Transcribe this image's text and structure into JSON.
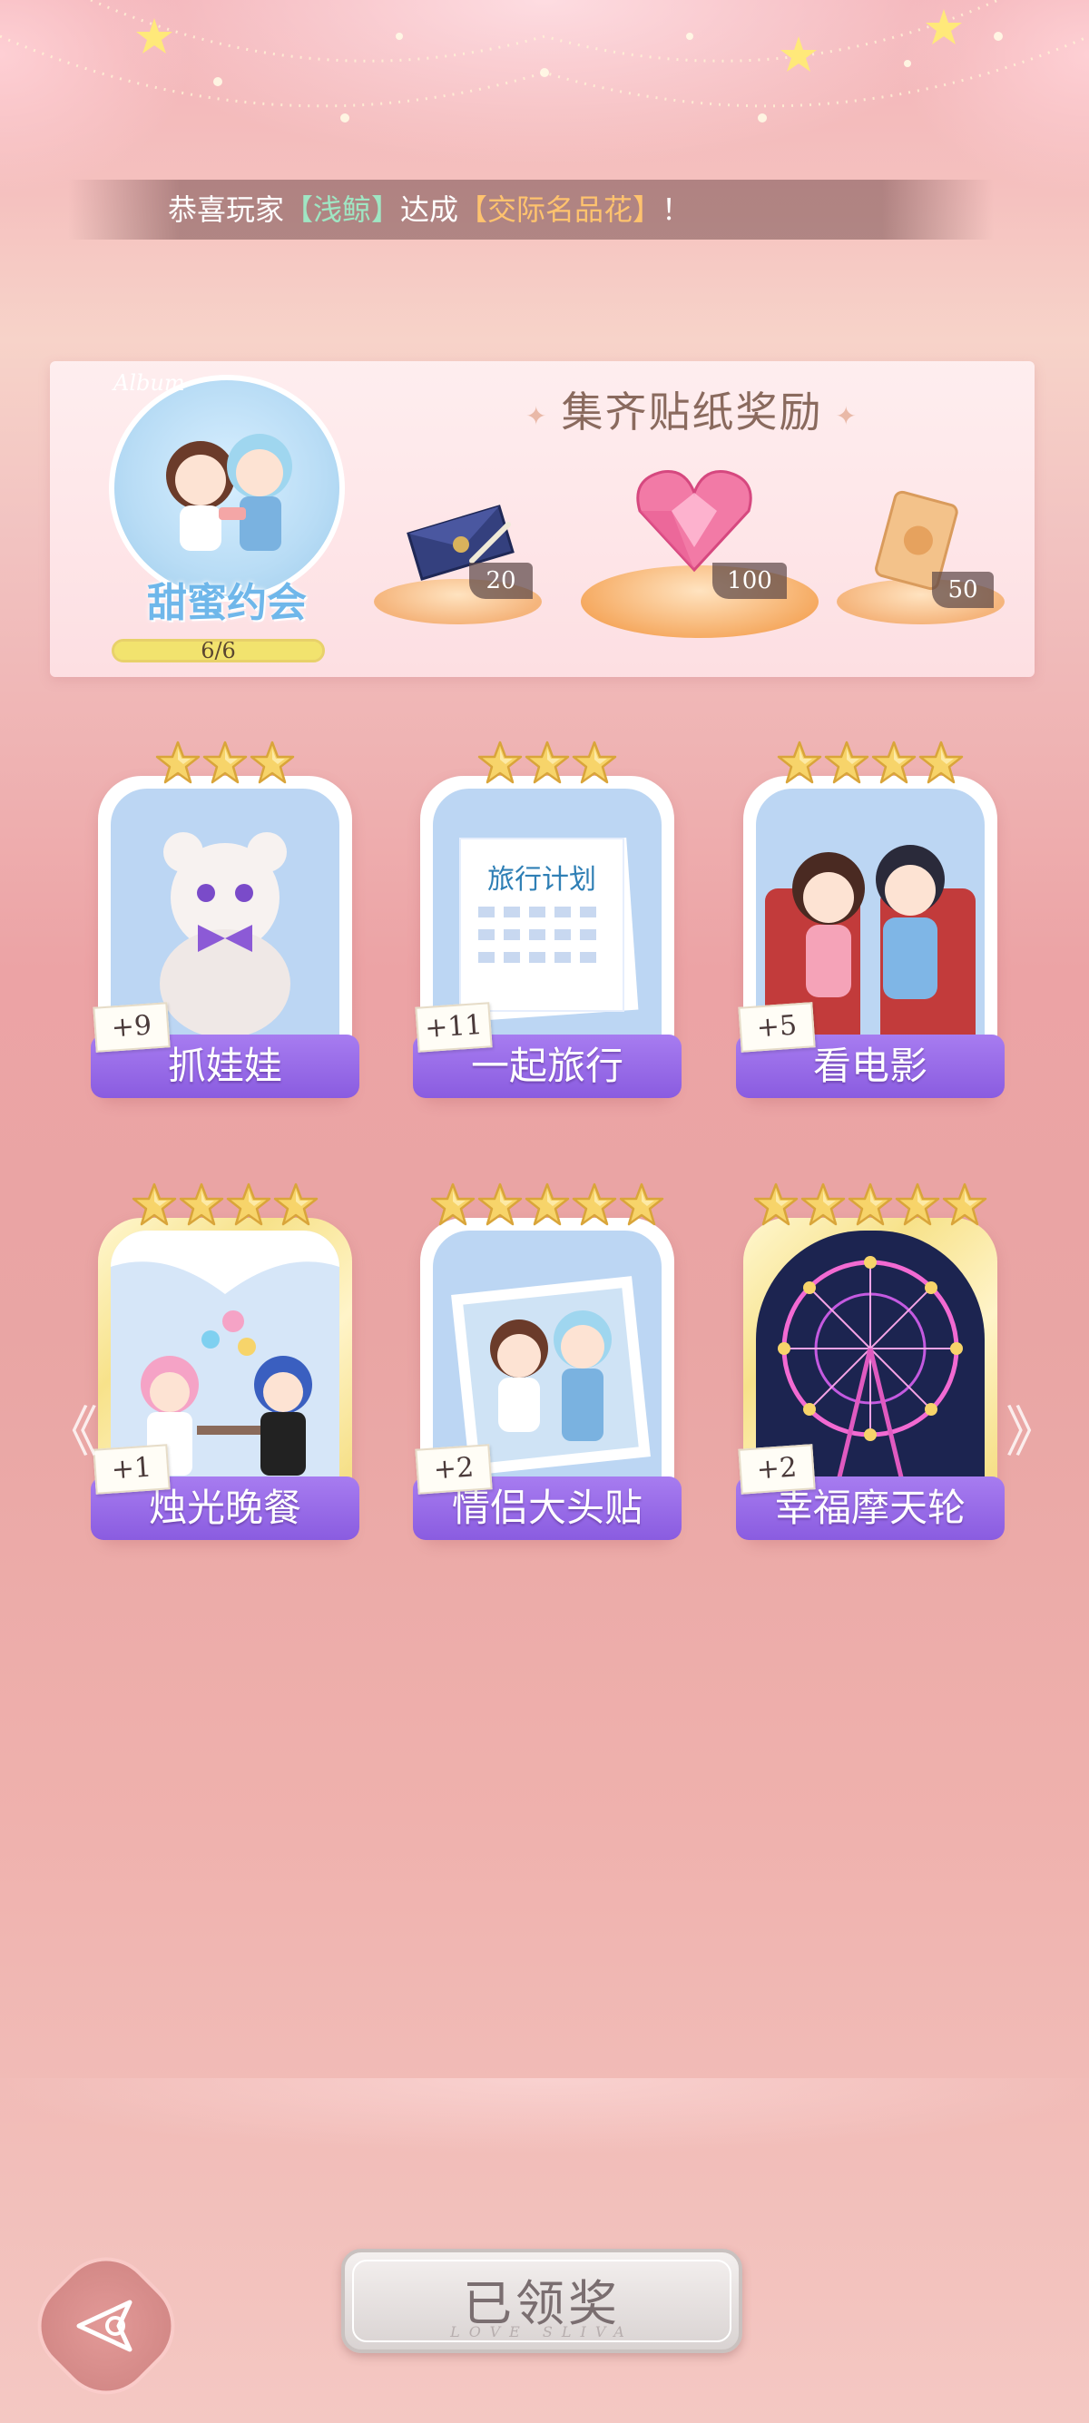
{
  "announcement": {
    "prefix": "恭喜玩家",
    "player": "【浅鲸】",
    "middle": "达成",
    "title": "【交际名品花】",
    "suffix": "！"
  },
  "album": {
    "label": "Album",
    "name": "甜蜜约会",
    "progress_text": "6/6",
    "progress_fraction": 1.0
  },
  "rewards": {
    "title": "集齐贴纸奖励",
    "items": [
      {
        "icon": "envelope-icon",
        "count": "20"
      },
      {
        "icon": "pink-heart-gem-icon",
        "count": "100"
      },
      {
        "icon": "gold-card-icon",
        "count": "50"
      }
    ]
  },
  "stickers": [
    {
      "name": "抓娃娃",
      "count": "+9",
      "stars": 3,
      "gold": false,
      "icon": "teddy-bear-icon"
    },
    {
      "name": "一起旅行",
      "count": "+11",
      "stars": 3,
      "gold": false,
      "icon": "travel-plan-calendar-icon"
    },
    {
      "name": "看电影",
      "count": "+5",
      "stars": 4,
      "gold": false,
      "icon": "couple-cinema-icon"
    },
    {
      "name": "烛光晚餐",
      "count": "+1",
      "stars": 4,
      "gold": true,
      "icon": "candlelight-dinner-icon"
    },
    {
      "name": "情侣大头贴",
      "count": "+2",
      "stars": 5,
      "gold": false,
      "icon": "couple-photo-icon"
    },
    {
      "name": "幸福摩天轮",
      "count": "+2",
      "stars": 5,
      "gold": true,
      "icon": "ferris-wheel-icon"
    }
  ],
  "travel_plan_text": "旅行计划",
  "nav": {
    "prev_arrow": "《",
    "next_arrow": "》"
  },
  "claim_button": {
    "label": "已领奖",
    "sub": "LOVE SLIVA"
  },
  "colors": {
    "banner": "#9a6be8",
    "accent_gold": "#f7d46a",
    "player_name": "#9fe6c3",
    "title_name": "#ffc36e"
  }
}
